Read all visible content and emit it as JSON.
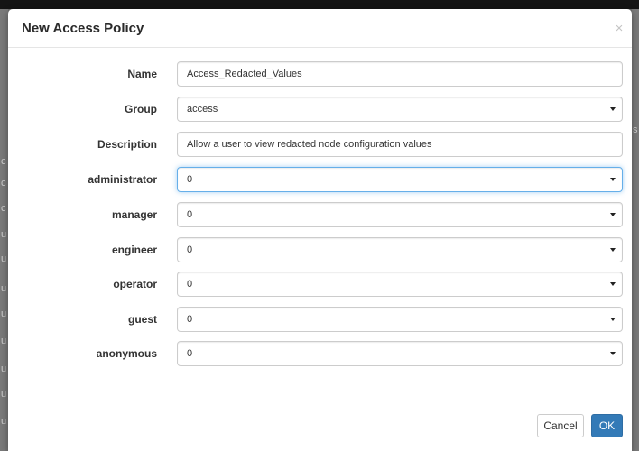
{
  "modal": {
    "title": "New Access Policy",
    "close_glyph": "×",
    "close_icon": "close-icon"
  },
  "form": {
    "name": {
      "label": "Name",
      "value": "Access_Redacted_Values"
    },
    "group": {
      "label": "Group",
      "value": "access"
    },
    "description": {
      "label": "Description",
      "value": "Allow a user to view redacted node configuration values"
    },
    "roles": [
      {
        "label": "administrator",
        "value": "0"
      },
      {
        "label": "manager",
        "value": "0"
      },
      {
        "label": "engineer",
        "value": "0"
      },
      {
        "label": "operator",
        "value": "0"
      },
      {
        "label": "guest",
        "value": "0"
      },
      {
        "label": "anonymous",
        "value": "0"
      }
    ]
  },
  "background": {
    "left_edge_letters": [
      "c",
      "c",
      "c",
      "u",
      "u",
      "u",
      "u",
      "u",
      "u",
      "u",
      "u"
    ],
    "right_edge_letter": "s"
  },
  "footer": {
    "cancel_label": "Cancel",
    "ok_label": "OK"
  },
  "colors": {
    "primary": "#337ab7",
    "focus": "#66afe9"
  }
}
